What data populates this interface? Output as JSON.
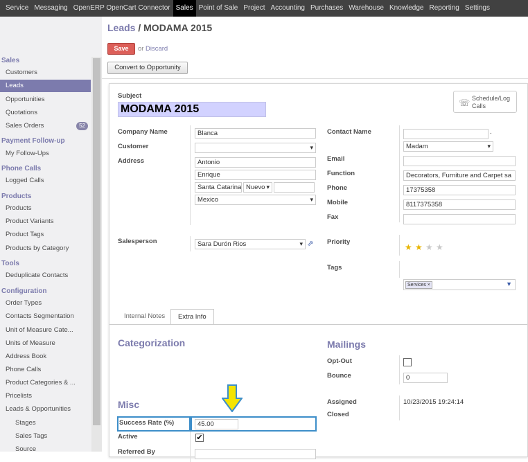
{
  "topnav": {
    "items": [
      "Service",
      "Messaging",
      "OpenERP OpenCart Connector",
      "Sales",
      "Point of Sale",
      "Project",
      "Accounting",
      "Purchases",
      "Warehouse",
      "Knowledge",
      "Reporting",
      "Settings"
    ],
    "active": "Sales"
  },
  "sidebar": {
    "sales_header": "Sales",
    "customers": "Customers",
    "leads": "Leads",
    "opportunities": "Opportunities",
    "quotations": "Quotations",
    "sales_orders": "Sales Orders",
    "sales_orders_badge": "52",
    "payment_header": "Payment Follow-up",
    "my_followups": "My Follow-Ups",
    "phone_header": "Phone Calls",
    "logged_calls": "Logged Calls",
    "products_header": "Products",
    "products": "Products",
    "product_variants": "Product Variants",
    "product_tags": "Product Tags",
    "products_by_category": "Products by Category",
    "tools_header": "Tools",
    "dedup_contacts": "Deduplicate Contacts",
    "config_header": "Configuration",
    "order_types": "Order Types",
    "contacts_segmentation": "Contacts Segmentation",
    "uom_categories": "Unit of Measure Cate...",
    "units_of_measure": "Units of Measure",
    "address_book": "Address Book",
    "phone_calls": "Phone Calls",
    "product_categories": "Product Categories & ...",
    "pricelists": "Pricelists",
    "leads_opps": "Leads & Opportunities",
    "stages": "Stages",
    "sales_tags": "Sales Tags",
    "source": "Source"
  },
  "header": {
    "breadcrumb_link": "Leads",
    "breadcrumb_sep": " / ",
    "title": "MODAMA 2015",
    "save": "Save",
    "or": "or",
    "discard": "Discard",
    "convert": "Convert to Opportunity"
  },
  "form": {
    "subject_label": "Subject",
    "subject_value": "MODAMA 2015",
    "schedule_btn": "Schedule/Log Calls",
    "company_label": "Company Name",
    "company_value": "Blanca",
    "customer_label": "Customer",
    "customer_value": "",
    "address_label": "Address",
    "street": "Antonio",
    "street2": "Enrique",
    "city": "Santa Catarina",
    "state": "Nuevo",
    "zip": "",
    "country": "Mexico",
    "salesperson_label": "Salesperson",
    "salesperson_value": "Sara Durón Rios",
    "contact_label": "Contact Name",
    "contact_value": "",
    "contact_dot": ".",
    "title_value": "Madam",
    "email_label": "Email",
    "email_value": "",
    "function_label": "Function",
    "function_value": "Decorators, Furniture and Carpet sa",
    "phone_label": "Phone",
    "phone_value": "17375358",
    "mobile_label": "Mobile",
    "mobile_value": "8117375358",
    "fax_label": "Fax",
    "fax_value": "",
    "priority_label": "Priority",
    "priority_stars": 2,
    "priority_max": 4,
    "tags_label": "Tags",
    "tag_value": "Services",
    "tag_remove": "×"
  },
  "tabs": {
    "internal_notes": "Internal Notes",
    "extra_info": "Extra Info"
  },
  "extra": {
    "categorization_title": "Categorization",
    "mailings_title": "Mailings",
    "optout_label": "Opt-Out",
    "bounce_label": "Bounce",
    "bounce_value": "0",
    "misc_title": "Misc",
    "success_label": "Success Rate (%)",
    "success_value": "45.00",
    "active_label": "Active",
    "active_check": "✔",
    "referred_label": "Referred By",
    "referred_value": "",
    "assigned_label": "Assigned",
    "assigned_value": "10/23/2015 19:24:14",
    "closed_label": "Closed"
  },
  "colors": {
    "accent": "#7c7bad",
    "save_button": "#dc5f59",
    "annotation_arrow": "#f5e400",
    "annotation_box": "#3d8ec9"
  }
}
